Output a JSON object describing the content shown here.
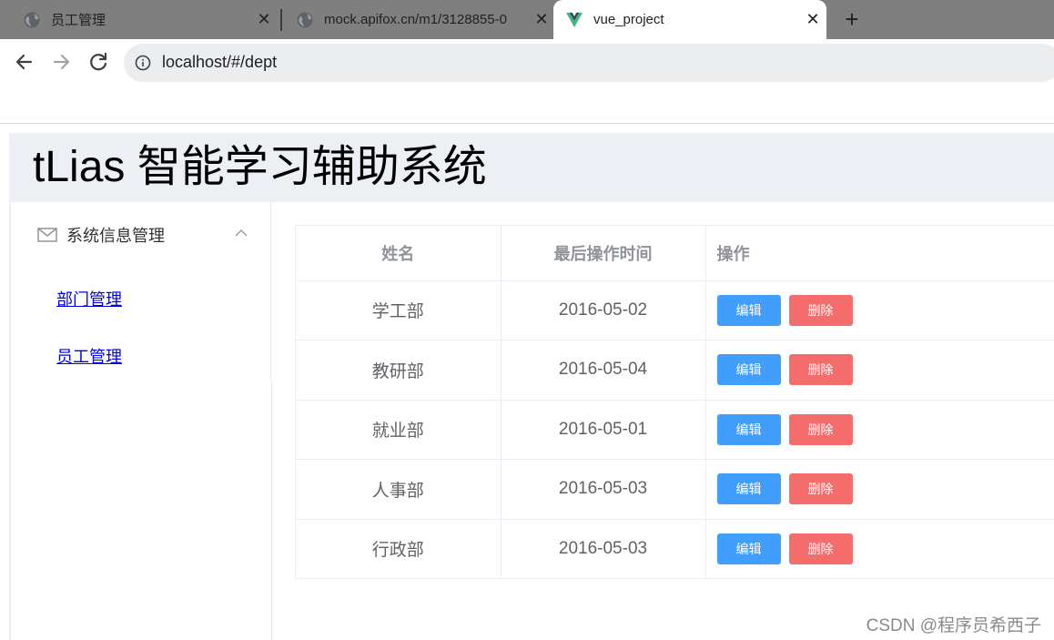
{
  "browser": {
    "tabs": [
      {
        "title": "员工管理",
        "icon": "globe-icon"
      },
      {
        "title": "mock.apifox.cn/m1/3128855-0",
        "icon": "globe-icon"
      },
      {
        "title": "vue_project",
        "icon": "vue-logo-icon",
        "active": true
      }
    ],
    "url": "localhost/#/dept"
  },
  "app": {
    "title": "tLias 智能学习辅助系统"
  },
  "sidebar": {
    "group_label": "系统信息管理",
    "items": [
      {
        "label": "部门管理"
      },
      {
        "label": "员工管理"
      }
    ]
  },
  "table": {
    "columns": [
      "姓名",
      "最后操作时间",
      "操作"
    ],
    "rows": [
      {
        "name": "学工部",
        "time": "2016-05-02"
      },
      {
        "name": "教研部",
        "time": "2016-05-04"
      },
      {
        "name": "就业部",
        "time": "2016-05-01"
      },
      {
        "name": "人事部",
        "time": "2016-05-03"
      },
      {
        "name": "行政部",
        "time": "2016-05-03"
      }
    ],
    "edit_label": "编辑",
    "delete_label": "删除"
  },
  "watermark": "CSDN @程序员希西子",
  "colors": {
    "edit_button": "#409eff",
    "delete_button": "#f56c6c",
    "header_bg": "#ecf0f5",
    "tabstrip_bg": "#7f7f7f"
  }
}
